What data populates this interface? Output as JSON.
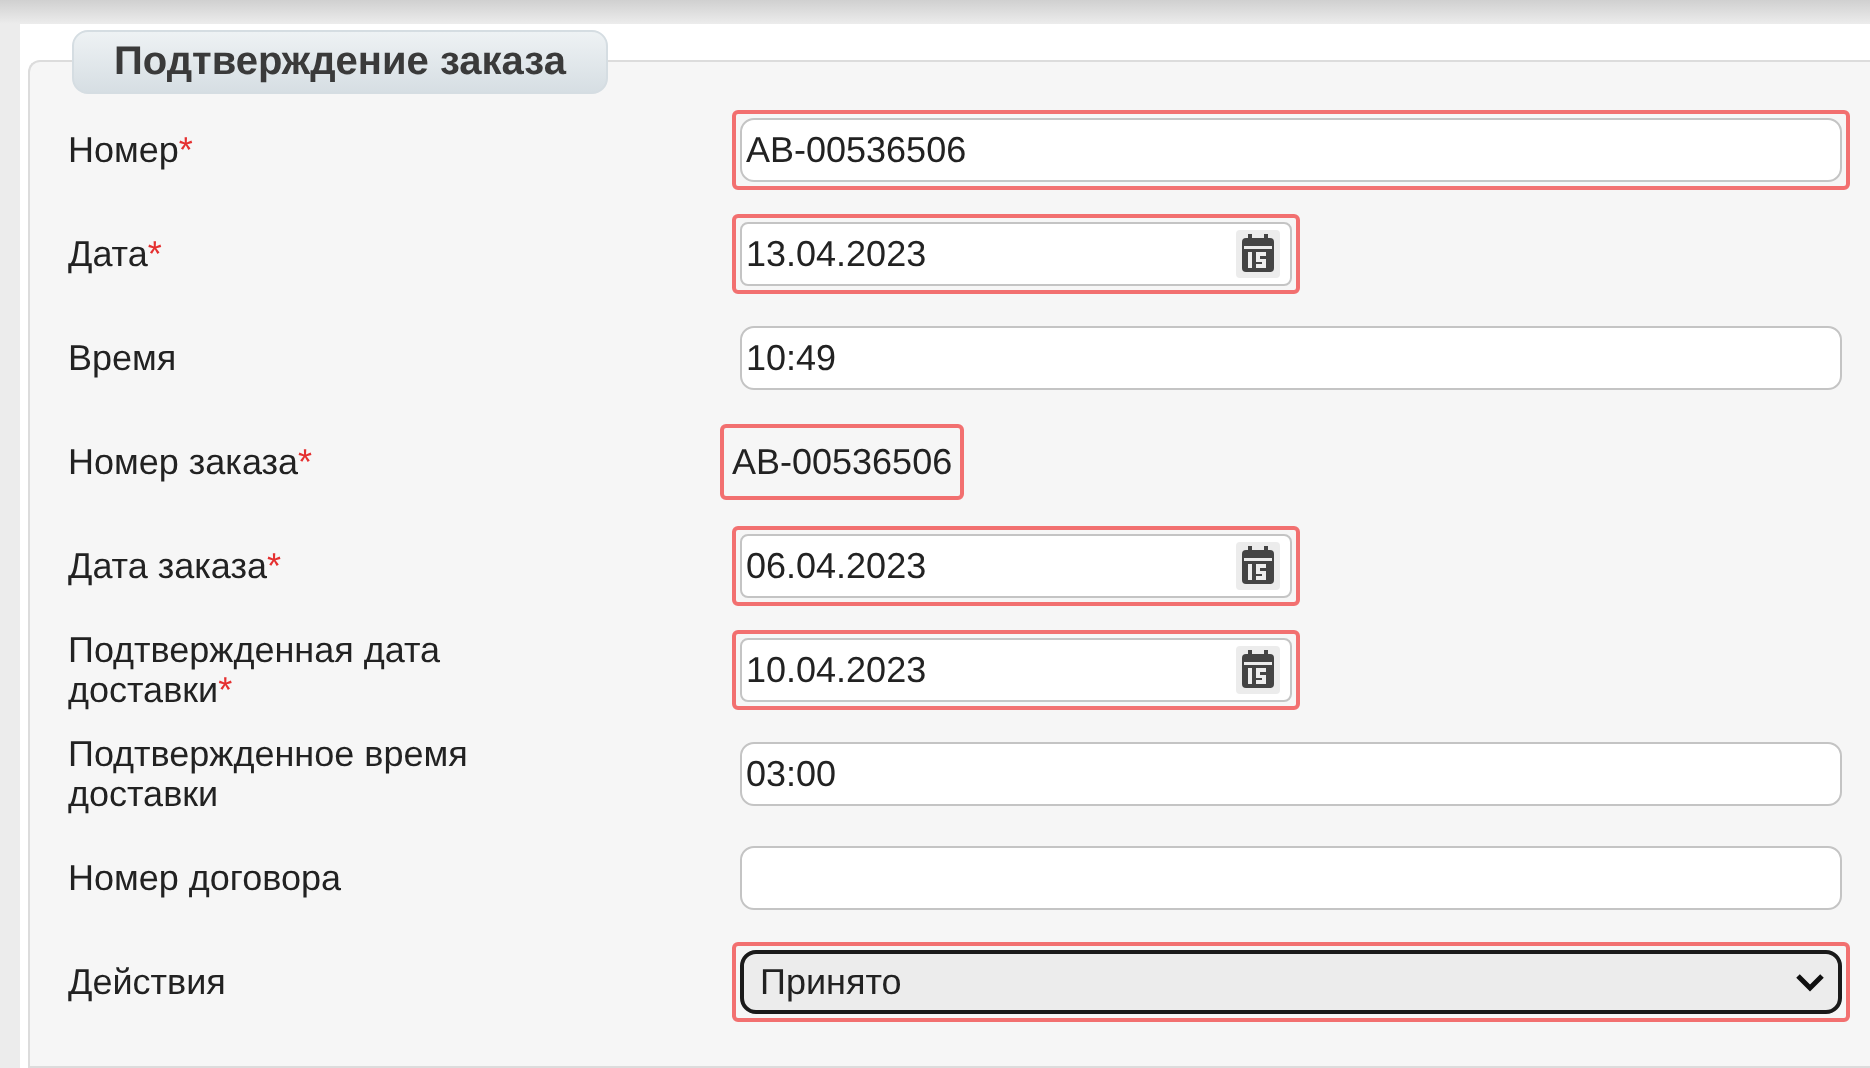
{
  "form": {
    "title": "Подтверждение заказа",
    "required_mark": "*",
    "fields": [
      {
        "label": "Номер",
        "required": true,
        "kind": "text",
        "value": "АВ-00536506",
        "highlighted": true
      },
      {
        "label": "Дата",
        "required": true,
        "kind": "date",
        "value": "13.04.2023",
        "highlighted": true
      },
      {
        "label": "Время",
        "required": false,
        "kind": "text",
        "value": "10:49",
        "highlighted": false
      },
      {
        "label": "Номер заказа",
        "required": true,
        "kind": "static",
        "value": "АВ-00536506",
        "highlighted": true
      },
      {
        "label": "Дата заказа",
        "required": true,
        "kind": "date",
        "value": "06.04.2023",
        "highlighted": true
      },
      {
        "label": "Подтвержденная дата доставки",
        "required": true,
        "kind": "date",
        "value": "10.04.2023",
        "highlighted": true
      },
      {
        "label": "Подтвержденное время доставки",
        "required": false,
        "kind": "text",
        "value": "03:00",
        "highlighted": false
      },
      {
        "label": "Номер договора",
        "required": false,
        "kind": "text",
        "highlighted": false
      },
      {
        "label": "Действия",
        "required": false,
        "kind": "select",
        "value": "Принято",
        "highlighted": true
      }
    ]
  }
}
